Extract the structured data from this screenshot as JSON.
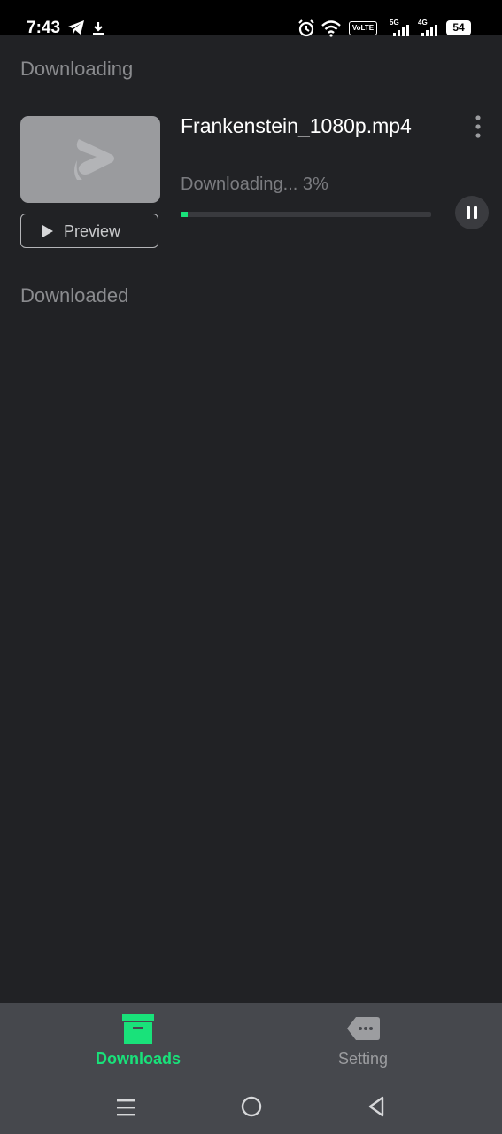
{
  "status_bar": {
    "time": "7:43",
    "battery": "54",
    "network_badge": "VoLTE",
    "sim1_tech": "5G",
    "sim2_tech": "4G",
    "icons": [
      "telegram-icon",
      "download-arrow-icon",
      "alarm-icon",
      "wifi-icon",
      "volte-icon",
      "signal-icon",
      "battery-icon"
    ]
  },
  "sections": {
    "downloading_title": "Downloading",
    "downloaded_title": "Downloaded"
  },
  "download_item": {
    "file_name": "Frankenstein_1080p.mp4",
    "status": "Downloading... 3%",
    "progress_percent": 3,
    "preview_label": "Preview"
  },
  "bottom_nav": {
    "downloads_label": "Downloads",
    "setting_label": "Setting",
    "active": "Downloads"
  },
  "colors": {
    "accent": "#19e27a",
    "background": "#212225",
    "nav_background": "#46484d"
  }
}
